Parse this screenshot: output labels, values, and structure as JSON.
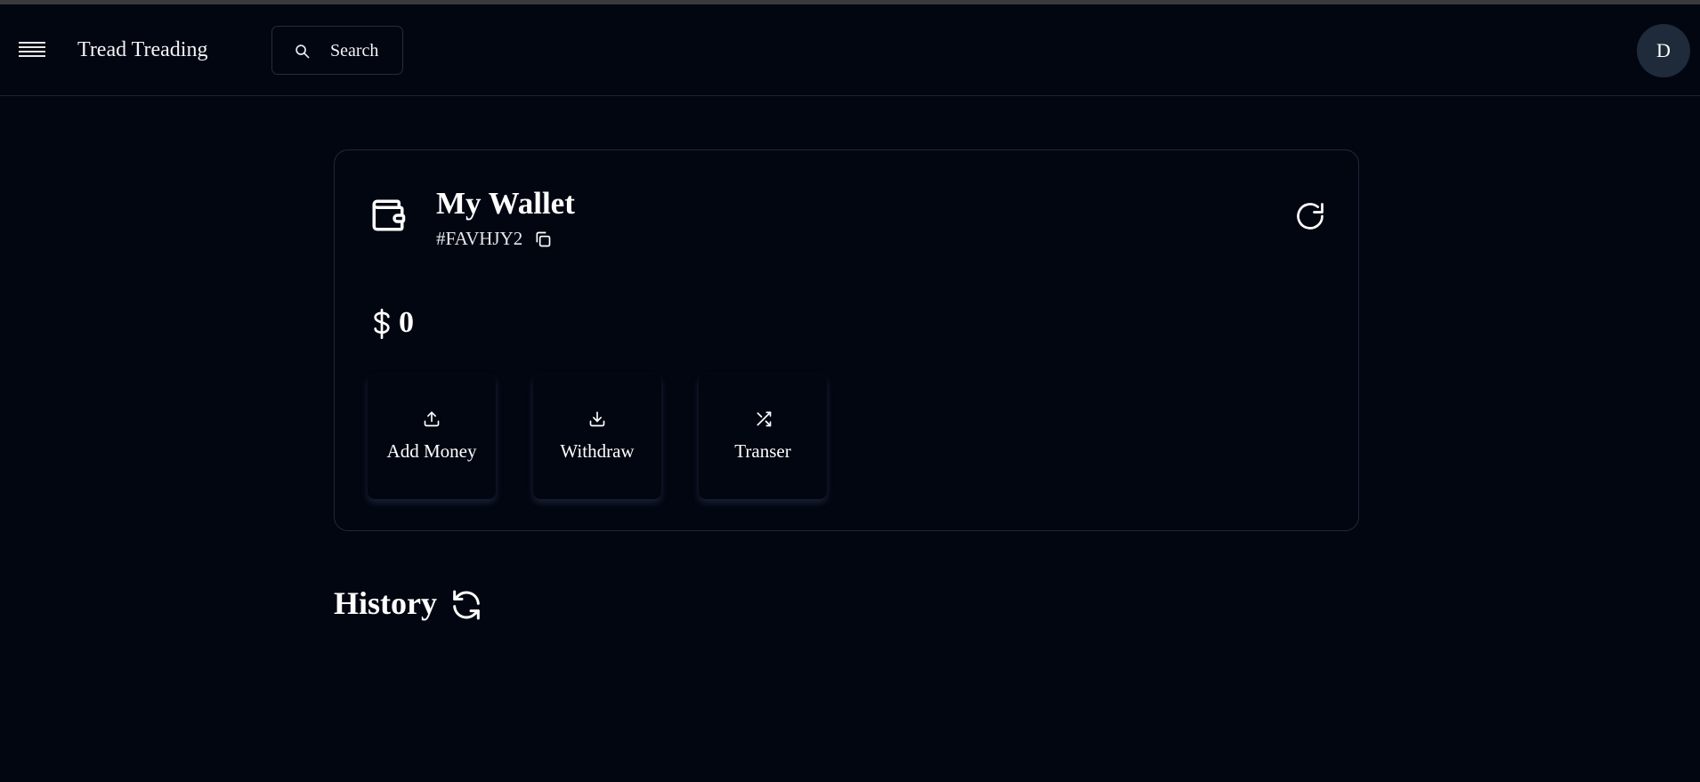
{
  "header": {
    "menu_icon": "menu-icon",
    "brand": "Tread Treading",
    "search_label": "Search",
    "search_icon": "search-icon",
    "avatar_initial": "D"
  },
  "wallet": {
    "icon": "wallet-icon",
    "title": "My Wallet",
    "id": "#FAVHJY2",
    "copy_icon": "copy-icon",
    "refresh_icon": "refresh-icon",
    "currency_icon": "dollar-icon",
    "balance": "0",
    "actions": [
      {
        "label": "Add Money",
        "icon": "upload-icon"
      },
      {
        "label": "Withdraw",
        "icon": "download-icon"
      },
      {
        "label": "Transer",
        "icon": "shuffle-icon"
      }
    ]
  },
  "history": {
    "title": "History",
    "refresh_icon": "sync-icon"
  },
  "colors": {
    "background": "#020611",
    "card_border": "#20283a",
    "avatar_bg": "#1f2a3a",
    "text": "#ffffff"
  }
}
